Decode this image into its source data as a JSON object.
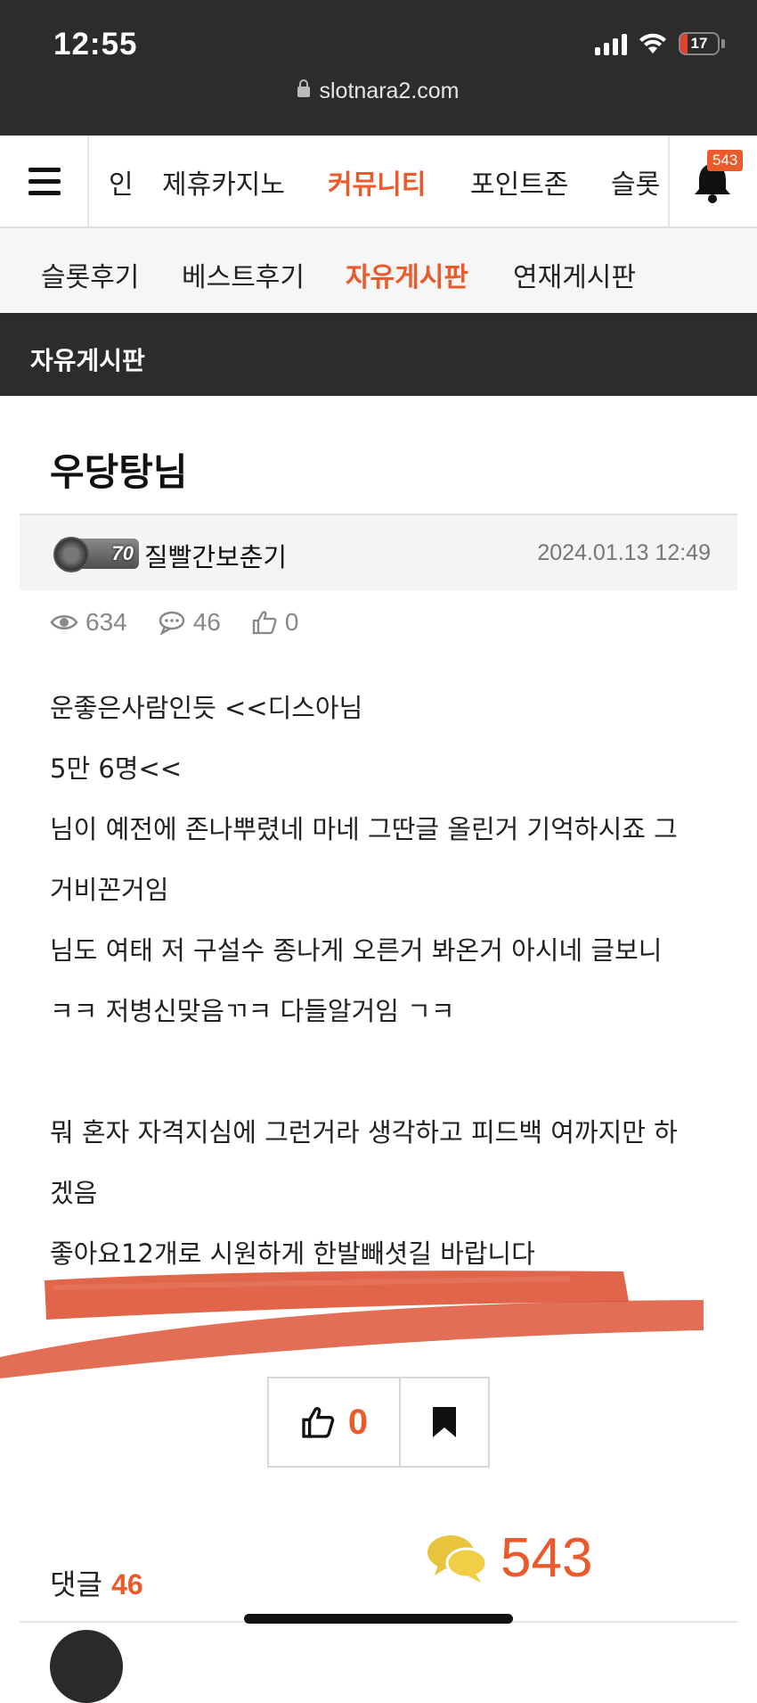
{
  "status_bar": {
    "time": "12:55",
    "battery": "17",
    "url": "slotnara2.com"
  },
  "top_nav": {
    "items": [
      "인",
      "제휴카지노",
      "커뮤니티",
      "포인트존",
      "슬롯"
    ],
    "active": "커뮤니티",
    "notification_count": "543"
  },
  "sub_nav": {
    "items": [
      "슬롯후기",
      "베스트후기",
      "자유게시판",
      "연재게시판"
    ],
    "active": "자유게시판"
  },
  "board_title": "자유게시판",
  "post": {
    "title": "우당탕님",
    "author": {
      "level": "70",
      "name": "질빨간보춘기"
    },
    "date": "2024.01.13 12:49",
    "views": "634",
    "comments": "46",
    "likes": "0",
    "body_lines": [
      "운좋은사람인듯 <<디스아님",
      "5만 6명<<",
      "님이 예전에 존나뿌렸네 마네 그딴글 올린거 기억하시죠 그",
      "거비꼰거임",
      "님도 여태 저 구설수 종나게 오른거 봐온거 아시네 글보니",
      "ㅋㅋ 저병신맞음ㄲㅋ 다들알거임 ㄱㅋ",
      "",
      "뭐 혼자 자격지심에 그런거라 생각하고 피드백 여까지만 하",
      "겠음",
      "좋아요12개로 시원하게 한발빼셧길 바랍니다"
    ]
  },
  "actions": {
    "like_count": "0"
  },
  "comment_section": {
    "label": "댓글",
    "count": "46",
    "chat_float_count": "543"
  },
  "colors": {
    "accent": "#ea5a2b",
    "dark": "#2c2c2c",
    "scribble": "#dc4a2c"
  },
  "icons": [
    "lock-icon",
    "menu-icon",
    "bell-icon",
    "eye-icon",
    "comment-icon",
    "thumbs-up-icon",
    "bookmark-icon",
    "chat-bubble-icon"
  ]
}
